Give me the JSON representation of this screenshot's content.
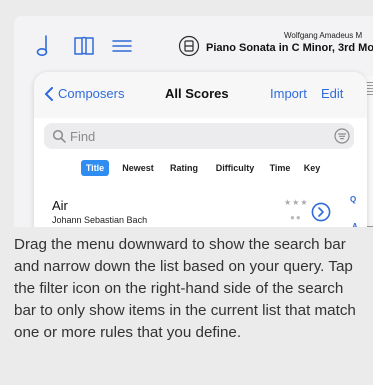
{
  "toolbar": {
    "icons": [
      "music-note-icon",
      "library-book-icon",
      "menu-lines-icon",
      "score-badge-icon"
    ],
    "composer": "Wolfgang Amadeus M",
    "score_title": "Piano Sonata in C Minor, 3rd Mo"
  },
  "nav": {
    "back_label": "Composers",
    "title": "All Scores",
    "import_label": "Import",
    "edit_label": "Edit"
  },
  "search": {
    "placeholder": "Find",
    "value": ""
  },
  "sort_tabs": [
    "Title",
    "Newest",
    "Rating",
    "Difficulty",
    "Time",
    "Key"
  ],
  "sort_active": "Title",
  "list": [
    {
      "title": "Air",
      "composer": "Johann Sebastian Bach",
      "rating": "★★★",
      "difficulty": "●●"
    }
  ],
  "index": [
    "Q",
    "A"
  ],
  "caption": "Drag the menu downward to show the search bar and narrow down the list based on your query. Tap the filter icon on the right-hand side of the search bar to only show items in the current list that match one or more rules that you define.",
  "colors": {
    "accent": "#2f6bd9",
    "active_tab": "#2f8cf0",
    "background": "#ebebeb"
  }
}
